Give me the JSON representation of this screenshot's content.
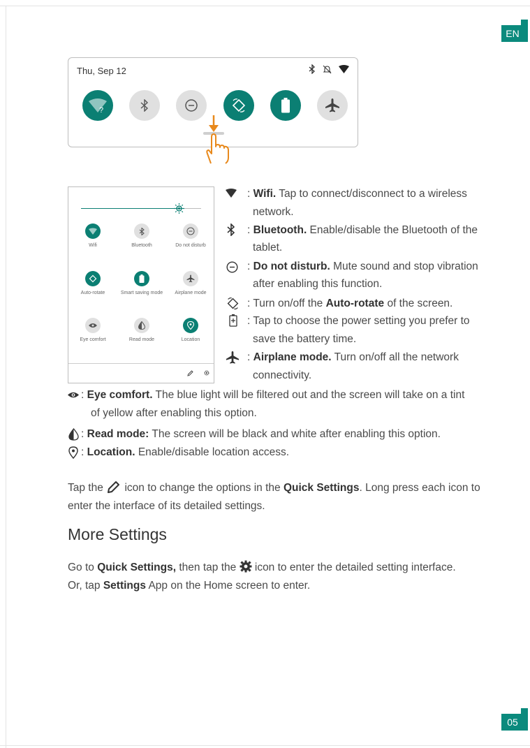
{
  "lang_tab": "EN",
  "page_number": "05",
  "shade": {
    "date": "Thu, Sep 12",
    "toggles": [
      {
        "name": "wifi",
        "state": "on"
      },
      {
        "name": "bluetooth",
        "state": "off"
      },
      {
        "name": "do-not-disturb",
        "state": "off"
      },
      {
        "name": "auto-rotate",
        "state": "on"
      },
      {
        "name": "battery-saver",
        "state": "on"
      },
      {
        "name": "airplane",
        "state": "off"
      }
    ]
  },
  "panel": {
    "tiles": [
      {
        "label": "Wifi",
        "state": "on"
      },
      {
        "label": "Bluetooth",
        "state": "off"
      },
      {
        "label": "Do not disturb",
        "state": "off"
      },
      {
        "label": "Auto-rotate",
        "state": "on"
      },
      {
        "label": "Smart saving mode",
        "state": "on"
      },
      {
        "label": "Airplane mode",
        "state": "off"
      },
      {
        "label": "Eye comfort",
        "state": "off"
      },
      {
        "label": "Read mode",
        "state": "off"
      },
      {
        "label": "Location",
        "state": "on"
      }
    ]
  },
  "descriptions": {
    "wifi_bold": "Wifi.",
    "wifi_text": " Tap to connect/disconnect to a wireless",
    "wifi_text2": "network.",
    "bt_bold": "Bluetooth.",
    "bt_text": " Enable/disable the Bluetooth of the",
    "bt_text2": "tablet.",
    "dnd_bold": "Do not disturb.",
    "dnd_text": " Mute sound and stop vibration",
    "dnd_text2": "after enabling this function.",
    "rotate_pre": "Turn on/off the ",
    "rotate_bold": "Auto-rotate",
    "rotate_post": " of the screen.",
    "power_text": "Tap to choose the power setting you prefer to",
    "power_text2": "save the battery time.",
    "air_bold": "Airplane mode.",
    "air_text": " Turn on/off all the network",
    "air_text2": "connectivity.",
    "eye_bold": "Eye comfort.",
    "eye_text": " The blue light will be filtered out and the screen will take on a tint",
    "eye_text2": "of yellow after enabling this option.",
    "read_bold": "Read mode:",
    "read_text": " The screen will be black and white after enabling this option.",
    "loc_bold": "Location.",
    "loc_text": " Enable/disable location access.",
    "colon": ": "
  },
  "edit_para": {
    "pre": "Tap the ",
    "mid": " icon to change the options in the ",
    "bold": "Quick Settings",
    "post": ". Long press each icon to",
    "line2": "enter the interface of its detailed settings."
  },
  "more": {
    "heading": "More Settings",
    "l1_pre": "Go to ",
    "l1_bold": "Quick Settings,",
    "l1_mid": " then tap the ",
    "l1_post": " icon to enter the detailed setting interface.",
    "l2_pre": "Or, tap ",
    "l2_bold": "Settings",
    "l2_post": " App on the Home screen to enter."
  },
  "colors": {
    "accent": "#0b7f73",
    "tab": "#0b8a7d",
    "arrow": "#e8891c"
  }
}
